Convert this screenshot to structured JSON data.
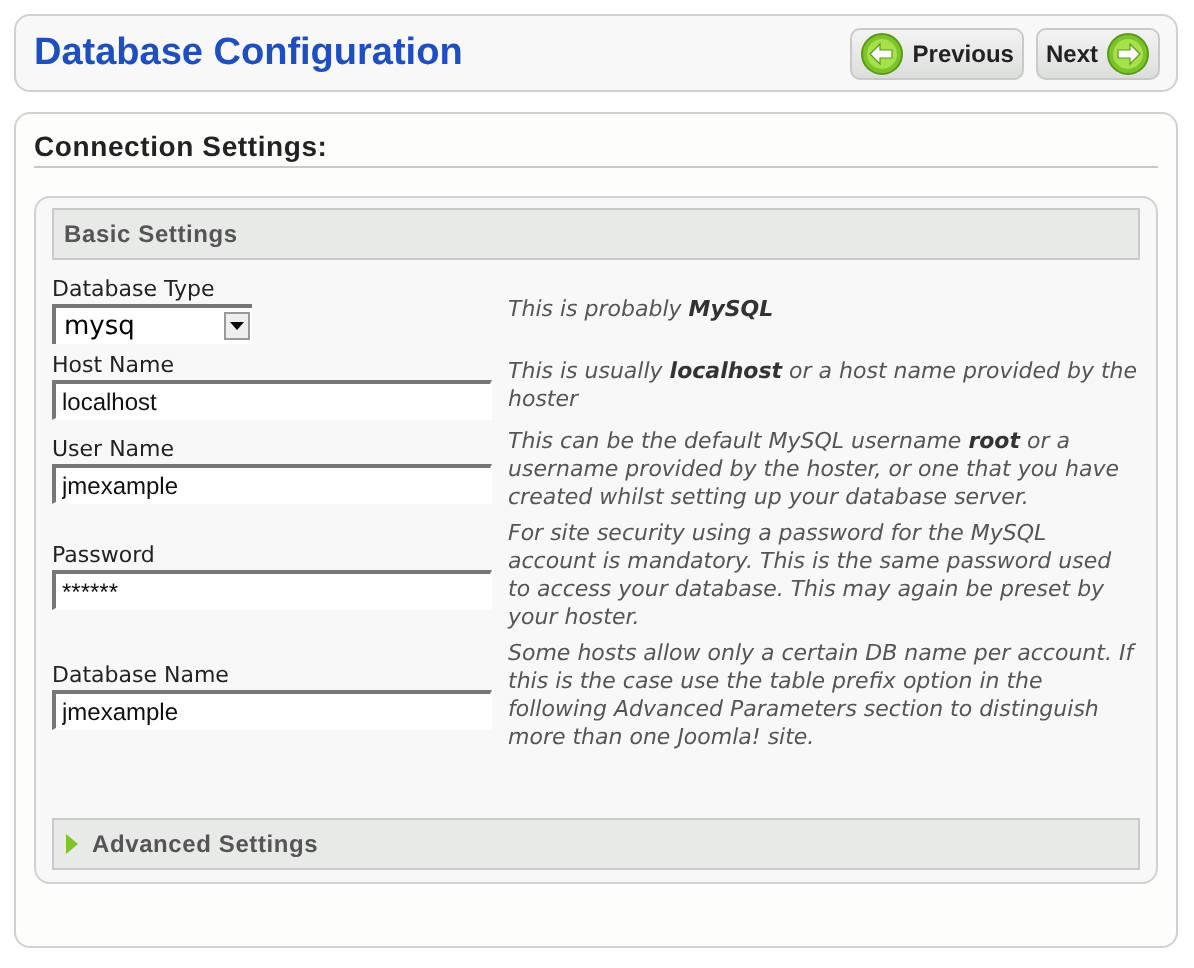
{
  "header": {
    "title": "Database Configuration",
    "buttons": [
      {
        "kind": "previous",
        "label": "Previous"
      },
      {
        "kind": "next",
        "label": "Next"
      }
    ]
  },
  "section": {
    "title": "Connection Settings:",
    "basic": {
      "title": "Basic Settings",
      "fields": [
        {
          "kind": "select",
          "label": "Database Type",
          "value": "mysq",
          "help": "This is probably **MySQL**"
        },
        {
          "kind": "text",
          "label": "Host Name",
          "value": "localhost",
          "help": "This is usually **localhost** or a host name provided by the hoster"
        },
        {
          "kind": "text",
          "label": "User Name",
          "value": "jmexample",
          "help": "This can be the default MySQL username **root** or a username provided by the hoster, or one that you have created whilst setting up your database server."
        },
        {
          "kind": "text",
          "label": "Password",
          "value": "******",
          "help": "For site security using a password for the MySQL account is mandatory. This is the same password used to access your database. This may again be preset by your hoster."
        },
        {
          "kind": "text",
          "label": "Database Name",
          "value": "jmexample",
          "help": "Some hosts allow only a certain DB name per account. If this is the case use the table prefix option in the following Advanced Parameters section to distinguish more than one Joomla! site."
        }
      ]
    },
    "advanced": {
      "title": "Advanced Settings",
      "expanded": false
    }
  }
}
